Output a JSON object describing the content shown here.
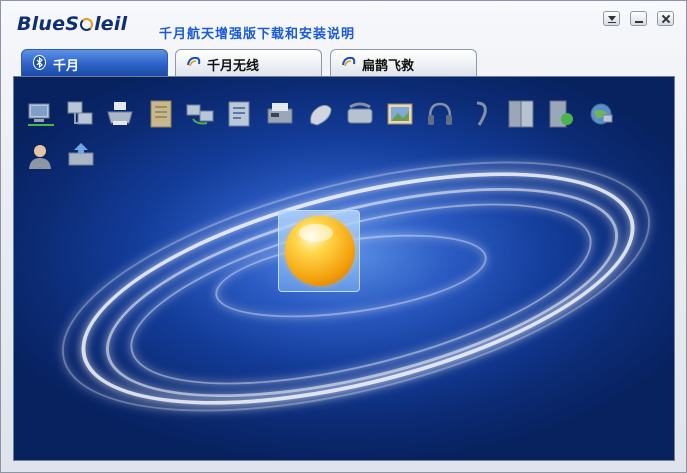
{
  "app": {
    "logo_prefix": "BlueS",
    "logo_suffix": "leil",
    "title": "千月航天增强版下载和安装说明"
  },
  "window_controls": {
    "menu_icon": "dropdown-icon",
    "minimize_icon": "minimize-icon",
    "close_icon": "close-icon"
  },
  "tabs": [
    {
      "label": "千月",
      "icon": "bluetooth-icon",
      "active": true
    },
    {
      "label": "千月无线",
      "icon": "swirl-icon",
      "active": false
    },
    {
      "label": "扁鹊飞救",
      "icon": "swirl-icon",
      "active": false
    }
  ],
  "devices": [
    {
      "icon": "network-computer-icon"
    },
    {
      "icon": "lan-access-icon"
    },
    {
      "icon": "printer-icon"
    },
    {
      "icon": "file-transfer-icon"
    },
    {
      "icon": "pc-to-pc-icon"
    },
    {
      "icon": "object-push-icon"
    },
    {
      "icon": "fax-printer-icon"
    },
    {
      "icon": "mouse-icon"
    },
    {
      "icon": "phone-icon"
    },
    {
      "icon": "image-icon"
    },
    {
      "icon": "headphones-icon"
    },
    {
      "icon": "headset-icon"
    },
    {
      "icon": "sync-icon"
    },
    {
      "icon": "folder-sync-icon"
    },
    {
      "icon": "globe-network-icon"
    },
    {
      "icon": "user-icon"
    },
    {
      "icon": "scanner-icon"
    }
  ],
  "colors": {
    "accent": "#2c63c7",
    "title_text": "#1a5bd6",
    "background": "#0c2b75",
    "sun": "#f4a10d"
  }
}
